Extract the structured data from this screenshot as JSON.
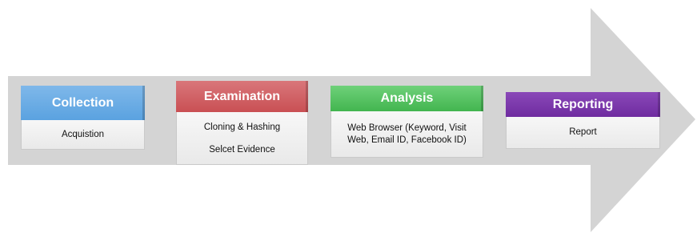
{
  "diagram": {
    "arrow_color": "#d4d4d4",
    "stages": [
      {
        "title": "Collection",
        "color": "#5aa2e0",
        "lines": [
          "Acquistion"
        ]
      },
      {
        "title": "Examination",
        "color": "#c95054",
        "lines": [
          "Cloning & Hashing",
          "Selcet Evidence"
        ]
      },
      {
        "title": "Analysis",
        "color": "#42b54f",
        "lines": [
          "Web Browser (Keyword, Visit",
          "Web, Email ID, Facebook ID)"
        ]
      },
      {
        "title": "Reporting",
        "color": "#6f2ca0",
        "lines": [
          "Report"
        ]
      }
    ]
  }
}
